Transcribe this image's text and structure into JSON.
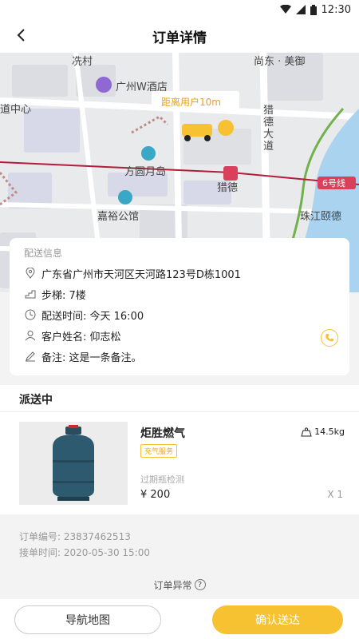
{
  "statusbar": {
    "time": "12:30"
  },
  "nav": {
    "title": "订单详情"
  },
  "map": {
    "labels": {
      "xiancun": "冼村",
      "shangdong": "尚东 · 美御",
      "hotel": "广州W酒店",
      "center": "道中心",
      "distance": "距离用户10m",
      "liede_ave": "猎德大道",
      "fangyuan": "方圆月岛",
      "liede": "猎德",
      "line6": "6号线",
      "jiayu": "嘉裕公馆",
      "zhujiang": "珠江颐德"
    }
  },
  "delivery": {
    "section_title": "配送信息",
    "address": "广东省广州市天河区天河路123号D栋1001",
    "stairs": "步梯: 7楼",
    "time": "配送时间: 今天 16:00",
    "customer": "客户姓名: 仰志松",
    "note": "备注: 这是一条备注。"
  },
  "status": {
    "label": "派送中"
  },
  "product": {
    "name": "炬胜燃气",
    "tag": "充气服务",
    "weight": "14.5kg",
    "sub": "过期瓶检测",
    "price": "¥ 200",
    "qty": "X 1"
  },
  "order": {
    "number": "订单编号: 23837462513",
    "time": "接单时间: 2020-05-30 15:00"
  },
  "exception": {
    "label": "订单异常",
    "help": "?"
  },
  "buttons": {
    "navigate": "导航地图",
    "confirm": "确认送达"
  }
}
